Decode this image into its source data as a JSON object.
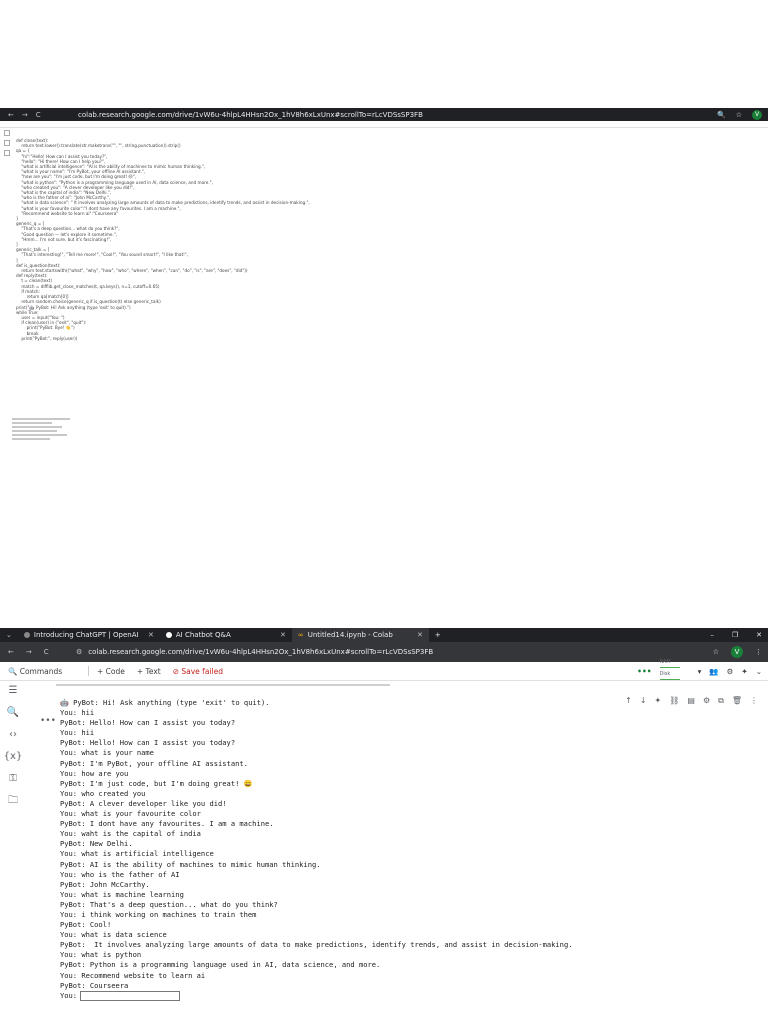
{
  "top": {
    "url": "colab.research.google.com/drive/1vW6u-4hlpL4HHsn2Ox_1hV8h6xLxUnx#scrollTo=rLcVDSsSP3FB",
    "code_lines": [
      "def clean(text):",
      "    return text.lower().translate(str.maketrans(\"\", \"\", string.punctuation)).strip()",
      "",
      "qa = {",
      "    \"hi\":\"Hello! How can I assist you today?\",",
      "    \"hello\": \"Hi there! How can I help you?\",",
      "    \"what is artificial intelligence\": \"AI is the ability of machines to mimic human thinking.\",",
      "    \"what is your name\": \"I'm PyBot, your offline AI assistant.\",",
      "    \"how are you\": \"I'm just code, but I'm doing great! 😄\",",
      "    \"what is python\": \"Python is a programming language used in AI, data science, and more.\",",
      "    \"who created you\": \"A clever developer like you did!\",",
      "    \"what is the capital of india\": \"New Delhi.\",",
      "    \"who is the father of ai\": \"John McCarthy.\",",
      "    \"what is data science\": \" It involves analyzing large amounts of data to make predictions, identify trends, and assist in decision-making.\",",
      "    \"what is your favourite color\":\"I dont have any favourites. I am a machine.\",",
      "    \"Recommend website to learn ai\":\"Courseera\"",
      "}",
      "",
      "generic_q = [",
      "    \"That's a deep question... what do you think?\",",
      "    \"Good question — let's explore it sometime.\",",
      "    \"Hmm... I'm not sure, but it's fascinating!\",",
      "]",
      "",
      "generic_talk = [",
      "    \"That's interesting!\", \"Tell me more!\", \"Cool!\", \"You sound smart!\", \"I like that!\",",
      "]",
      "",
      "def is_question(text):",
      "    return text.startswith((\"what\", \"why\", \"how\", \"who\", \"where\", \"when\", \"can\", \"do\", \"is\", \"are\", \"does\", \"did\"))",
      "",
      "def reply(text):",
      "    t = clean(text)",
      "    match = difflib.get_close_matches(t, qa.keys(), n=1, cutoff=0.65)",
      "    if match:",
      "        return qa[match[0]]",
      "    return random.choice(generic_q if is_question(t) else generic_talk)",
      "",
      "print(\"🤖 PyBot: Hi! Ask anything (type 'exit' to quit).\")",
      "while True:",
      "    user = input(\"You: \")",
      "    if clean(user) in (\"exit\", \"quit\"):",
      "        print(\"PyBot: Bye! 👋\")",
      "        break",
      "    print(\"PyBot:\", reply(user))"
    ]
  },
  "bottom": {
    "tabs": [
      {
        "label": "Introducing ChatGPT | OpenAI"
      },
      {
        "label": "AI Chatbot Q&A"
      },
      {
        "label": "Untitled14.ipynb - Colab"
      }
    ],
    "url": "colab.research.google.com/drive/1vW6u-4hlpL4HHsn2Ox_1hV8h6xLxUnx#scrollTo=rLcVDSsSP3FB",
    "avatar": "V",
    "toolbar": {
      "commands": "Commands",
      "add_code": "+ Code",
      "add_text": "+ Text",
      "save_status": "Save failed",
      "ram": "RAM",
      "disk": "Disk"
    },
    "output_lines": [
      "🤖 PyBot: Hi! Ask anything (type 'exit' to quit).",
      "You: hii",
      "PyBot: Hello! How can I assist you today?",
      "You: hii",
      "PyBot: Hello! How can I assist you today?",
      "You: what is your name",
      "PyBot: I'm PyBot, your offline AI assistant.",
      "You: how are you",
      "PyBot: I'm just code, but I'm doing great! 😄",
      "You: who created you",
      "PyBot: A clever developer like you did!",
      "You: what is your favourite color",
      "PyBot: I dont have any favourites. I am a machine.",
      "You: waht is the capital of india",
      "PyBot: New Delhi.",
      "You: what is artificial intelligence",
      "PyBot: AI is the ability of machines to mimic human thinking.",
      "You: who is the father of AI",
      "PyBot: John McCarthy.",
      "You: what is machine learning",
      "PyBot: That's a deep question... what do you think?",
      "You: i think working on machines to train them",
      "PyBot: Cool!",
      "You: what is data science",
      "PyBot:  It involves analyzing large amounts of data to make predictions, identify trends, and assist in decision-making.",
      "You: what is python",
      "PyBot: Python is a programming language used in AI, data science, and more.",
      "You: Recommend website to learn ai",
      "PyBot: Courseera"
    ],
    "input_prompt": "You:",
    "input_value": ""
  }
}
